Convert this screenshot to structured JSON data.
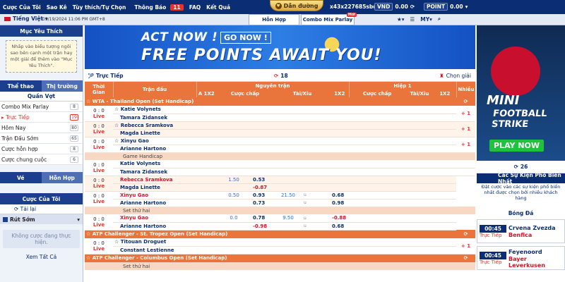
{
  "topbar": {
    "nav": [
      "Cược Của Tôi",
      "Sao Kê",
      "Tùy thích/Tự Chọn",
      "Thông Báo",
      "FAQ",
      "Kết Quả"
    ],
    "notifications": "11",
    "guide": "Dẫn đường",
    "user_id": "x43x227685sbd",
    "currency": "VND",
    "balance": "0.00",
    "point_label": "POINT",
    "point_value": "0.00"
  },
  "subbar": {
    "language": "Tiếng Việt",
    "clock": "09/19/2024 11:06 PM GMT+8",
    "tab_hon_hop": "Hỗn Hợp",
    "tab_combo": "Combo Mix Parlay",
    "new_tag": "Mới",
    "my": "MY"
  },
  "left": {
    "favorites_title": "Mục Yêu Thích",
    "favorites_note": "Nhấp vào biểu tượng ngôi sao bên cạnh một trận hay một giải để thêm vào \"Mục Yêu Thích\".",
    "tab_sport": "Thể thao",
    "tab_market": "Thị trường",
    "sport_title": "Quần Vợt",
    "sport_items": [
      {
        "label": "Combo Mix Parlay",
        "count": "8",
        "red": false
      },
      {
        "label": "Trực Tiếp",
        "count": "19",
        "red": true
      },
      {
        "label": "Hôm Nay",
        "count": "80",
        "red": false
      },
      {
        "label": "Trận Đấu Sớm",
        "count": "65",
        "red": false
      },
      {
        "label": "Cược hỗn hợp",
        "count": "8",
        "red": false
      },
      {
        "label": "Cược chung cuộc",
        "count": "6",
        "red": false
      }
    ],
    "tab_ve": "Vé",
    "tab_hon_hop": "Hỗn Hợp",
    "mybets_title": "Cược Của Tôi",
    "reload": "Tải lại",
    "early_cashout": "Rút Sớm",
    "no_bets": "Không cược đang thực hiện.",
    "see_all": "Xem Tất Cả"
  },
  "banner": {
    "line1": "ACT NOW !",
    "button": "GO NOW !",
    "line2": "FREE POINTS AWAIT YOU!"
  },
  "livebar": {
    "title": "Trực Tiếp",
    "count": "18",
    "pick": "Chọn giải"
  },
  "table": {
    "headers": {
      "time": "Thời Gian",
      "match": "Trận đấu",
      "full": "Nguyên trận",
      "half": "Hiệp 1",
      "more": "Nhiều",
      "x12": "A 1X2",
      "handicap": "Cược chấp",
      "ou": "Tài/Xỉu",
      "x12b": "1X2",
      "handicap2": "Cược chấp",
      "ou2": "Tài/Xỉu",
      "x12c": "1X2"
    },
    "league1": "WTA - Thailand Open (Set Handicap)",
    "game_handicap": "Game Handicap",
    "set2": "Set thứ hai",
    "league2": "ATP Challenger - St. Tropez Open (Set Handicap)",
    "league3": "ATP Challenger - Columbus Open (Set Handicap)",
    "set2b": "Set thứ hai",
    "score": "0 : 0",
    "live": "Live",
    "plus1": "+ 1",
    "rows": [
      {
        "t1": "Katie Volynets",
        "t2": "Tamara Zidansek",
        "h": "",
        "o1": "",
        "o2": "",
        "ou": "",
        "u1": "",
        "u2": "",
        "more": "+ 1"
      },
      {
        "t1": "Rebecca Sramkova",
        "t2": "Magda Linette",
        "h": "",
        "o1": "",
        "o2": "",
        "ou": "",
        "u1": "",
        "u2": "",
        "more": "+ 1"
      },
      {
        "t1": "Xinyu Gao",
        "t2": "Arianne Hartono",
        "h": "",
        "o1": "",
        "o2": "",
        "ou": "",
        "u1": "",
        "u2": "",
        "more": "+ 1"
      }
    ],
    "game_rows": [
      {
        "t1": "Katie Volynets",
        "t2": "Tamara Zidansek",
        "red": false,
        "h": "",
        "o1": "",
        "o2": "",
        "ou": "",
        "u": "",
        "u1": "",
        "u2": ""
      },
      {
        "t1": "Rebecca Sramkova",
        "t2": "Magda Linette",
        "red": true,
        "h": "1.50",
        "o1": "0.53",
        "o2": "-0.87",
        "ou": "",
        "u": "",
        "u1": "",
        "u2": ""
      },
      {
        "t1": "Xinyu Gao",
        "t2": "Arianne Hartono",
        "red": true,
        "h": "0.50",
        "o1": "0.93",
        "o2": "0.73",
        "ou": "21.50",
        "u": "u",
        "u1": "0.68",
        "u2": "0.98"
      }
    ],
    "set_row": {
      "t1": "Xinyu Gao",
      "t2": "Arianne Hartono",
      "h": "0.0",
      "o1": "0.78",
      "o2": "-0.98",
      "ou": "9.50",
      "u": "u",
      "u1": "-0.88",
      "u2": "0.68"
    },
    "st_row": {
      "t1": "Titouan Droguet",
      "t2": "Constant Lestienne",
      "more": "+ 1"
    }
  },
  "right": {
    "ad_line1": "MINI",
    "ad_line2": "FOOTBALL STRIKE",
    "ad_button": "PLAY NOW",
    "counter": "26",
    "highlights_title": "Các Sự Kiện Phổ Biến Nhất",
    "highlights_sub": "Đặt cược vào các sự kiện phổ biến nhất được chọn bởi nhiều khách hàng",
    "sport": "Bóng Đá",
    "events": [
      {
        "time": "00:45",
        "live": "Trực Tiếp",
        "t1": "Crvena Zvezda",
        "t2": "Benfica"
      },
      {
        "time": "00:45",
        "live": "Trực Tiếp",
        "t1": "Feyenoord",
        "t2": "Bayer Leverkusen"
      }
    ]
  }
}
